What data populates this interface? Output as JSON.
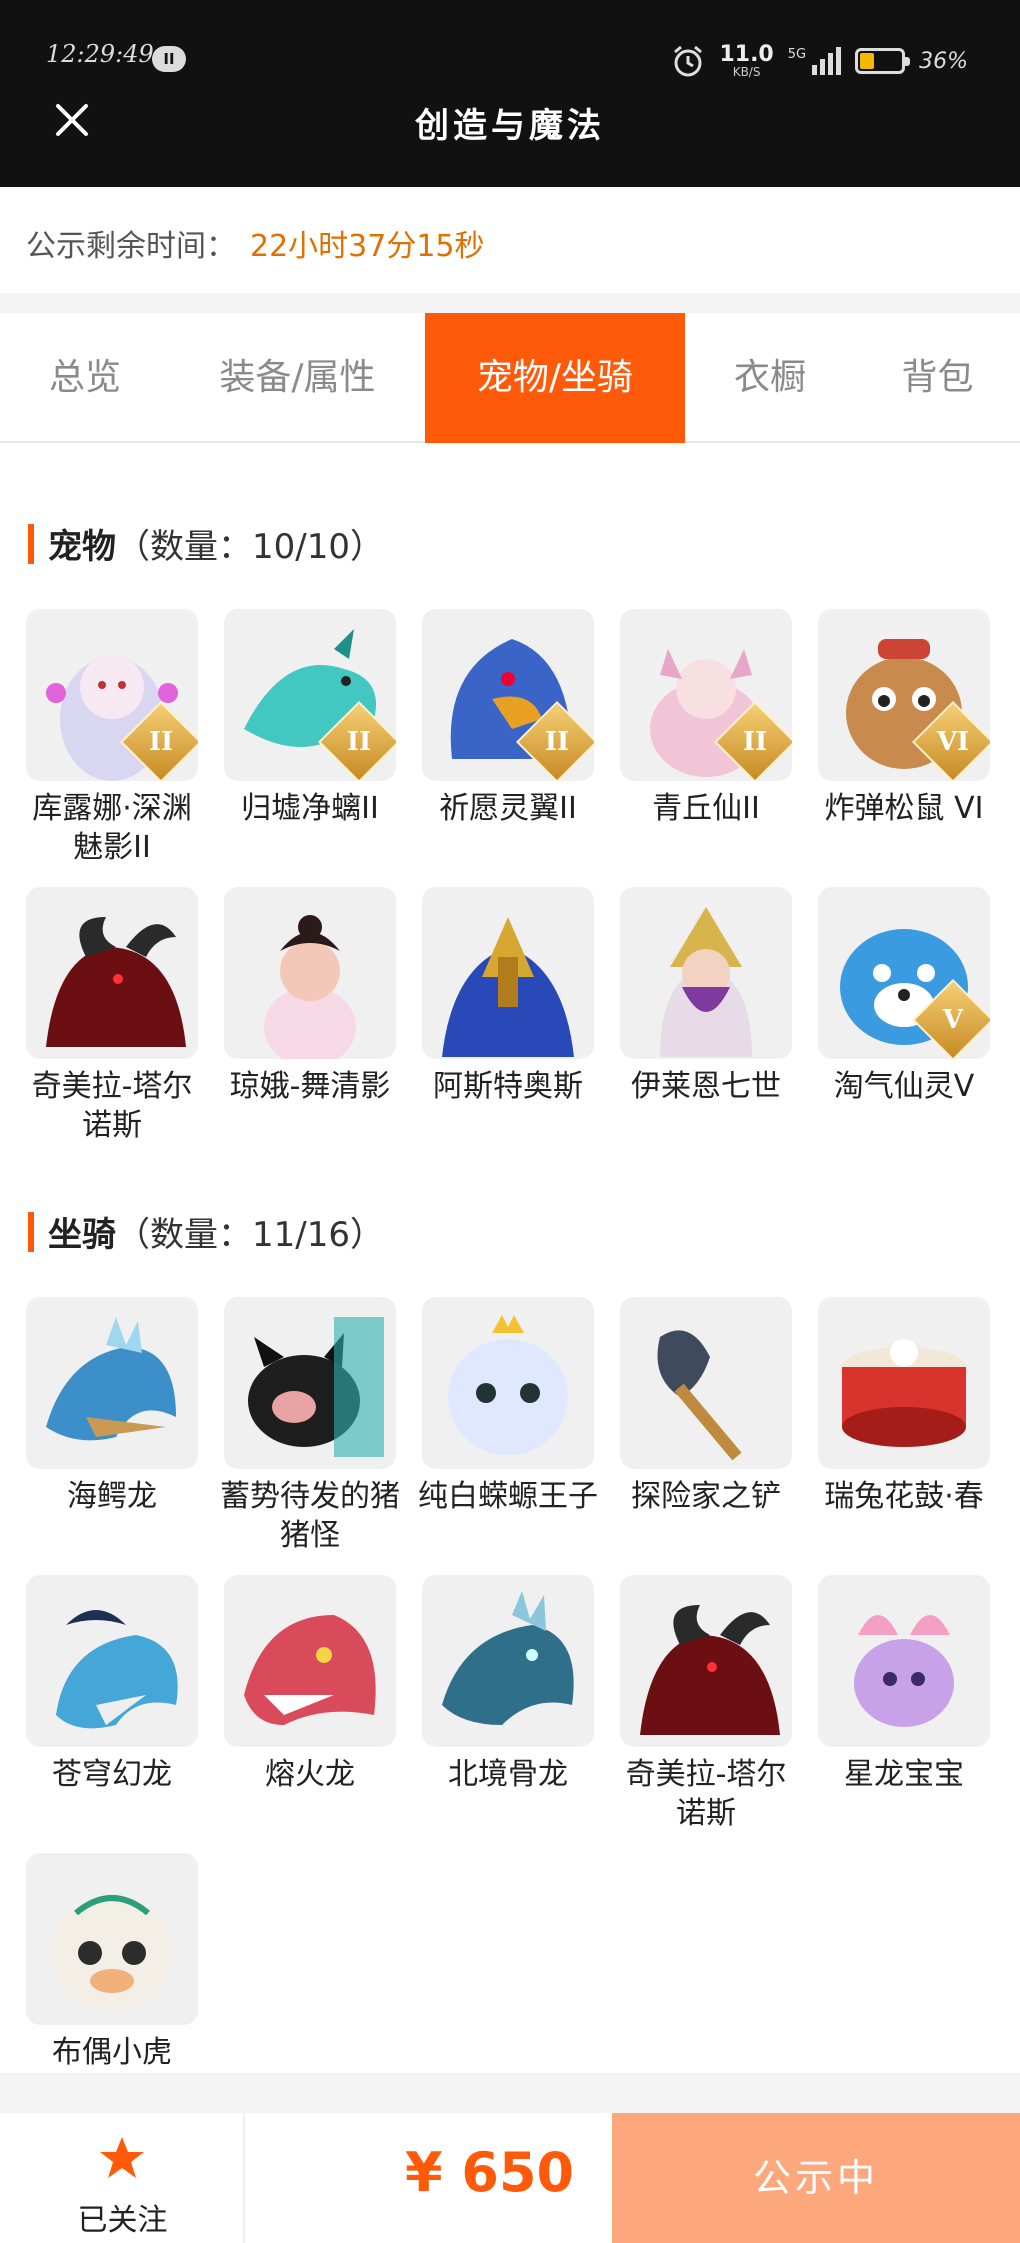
{
  "status_bar": {
    "time": "12:29:49",
    "pill": "II",
    "speed_value": "11.0",
    "speed_unit": "KB/S",
    "network": "5G",
    "battery_percent": "36%",
    "battery_level": 0.36,
    "battery_color": "#f5b800"
  },
  "header": {
    "title": "创造与魔法",
    "close_icon": "close-icon"
  },
  "notice": {
    "label": "公示剩余时间：",
    "value": "22小时37分15秒"
  },
  "tabs": [
    {
      "label": "总览",
      "active": false
    },
    {
      "label": "装备/属性",
      "active": false
    },
    {
      "label": "宠物/坐骑",
      "active": true
    },
    {
      "label": "衣橱",
      "active": false
    },
    {
      "label": "背包",
      "active": false
    }
  ],
  "pets": {
    "title": "宠物",
    "count": "（数量：10/10）",
    "items": [
      {
        "name": "库露娜·深渊魅影II",
        "badge": "II",
        "icon": "white-haired-girl",
        "color": "#d9d6f2"
      },
      {
        "name": "归墟净螭II",
        "badge": "II",
        "icon": "teal-dragon",
        "color": "#43c7c1"
      },
      {
        "name": "祈愿灵翼II",
        "badge": "II",
        "icon": "blue-eagle",
        "color": "#3b64c8"
      },
      {
        "name": "青丘仙II",
        "badge": "II",
        "icon": "fox-girl",
        "color": "#f1c4d8"
      },
      {
        "name": "炸弹松鼠 VI",
        "badge": "VI",
        "icon": "squirrel",
        "color": "#c98a4d"
      },
      {
        "name": "奇美拉-塔尔诺斯",
        "badge": "",
        "icon": "chimera",
        "color": "#2a2a2a"
      },
      {
        "name": "琼娥-舞清影",
        "badge": "",
        "icon": "dancer-girl",
        "color": "#f4c8b8"
      },
      {
        "name": "阿斯特奥斯",
        "badge": "",
        "icon": "blue-warrior",
        "color": "#2a49b8"
      },
      {
        "name": "伊莱恩七世",
        "badge": "",
        "icon": "pharaoh-queen",
        "color": "#d8b44c"
      },
      {
        "name": "淘气仙灵V",
        "badge": "V",
        "icon": "blue-pup",
        "color": "#3b9be0"
      }
    ]
  },
  "mounts": {
    "title": "坐骑",
    "count": "（数量：11/16）",
    "items": [
      {
        "name": "海鳄龙",
        "icon": "sea-dragon",
        "color": "#3c8fc9"
      },
      {
        "name": "蓄势待发的猪猪怪",
        "icon": "black-pig",
        "color": "#1e1e1e"
      },
      {
        "name": "纯白蝾螈王子",
        "icon": "white-axolotl",
        "color": "#dfe8ff"
      },
      {
        "name": "探险家之铲",
        "icon": "shovel",
        "color": "#3f4a5c"
      },
      {
        "name": "瑞兔花鼓·春",
        "icon": "red-drum",
        "color": "#d8332c"
      },
      {
        "name": "苍穹幻龙",
        "icon": "sky-dragon",
        "color": "#44a7d8"
      },
      {
        "name": "熔火龙",
        "icon": "lava-dragon",
        "color": "#d94a5a"
      },
      {
        "name": "北境骨龙",
        "icon": "bone-dragon",
        "color": "#2f6f8a"
      },
      {
        "name": "奇美拉-塔尔诺斯",
        "icon": "chimera",
        "color": "#2a2a2a"
      },
      {
        "name": "星龙宝宝",
        "icon": "star-dragon",
        "color": "#c8a2e8"
      },
      {
        "name": "布偶小虎",
        "icon": "toy-tiger",
        "color": "#f2b07a"
      }
    ]
  },
  "bottom_bar": {
    "follow_label": "已关注",
    "follow_icon": "star-icon",
    "price": "¥ 650",
    "status": "公示中",
    "accent": "#ff5a0a"
  }
}
